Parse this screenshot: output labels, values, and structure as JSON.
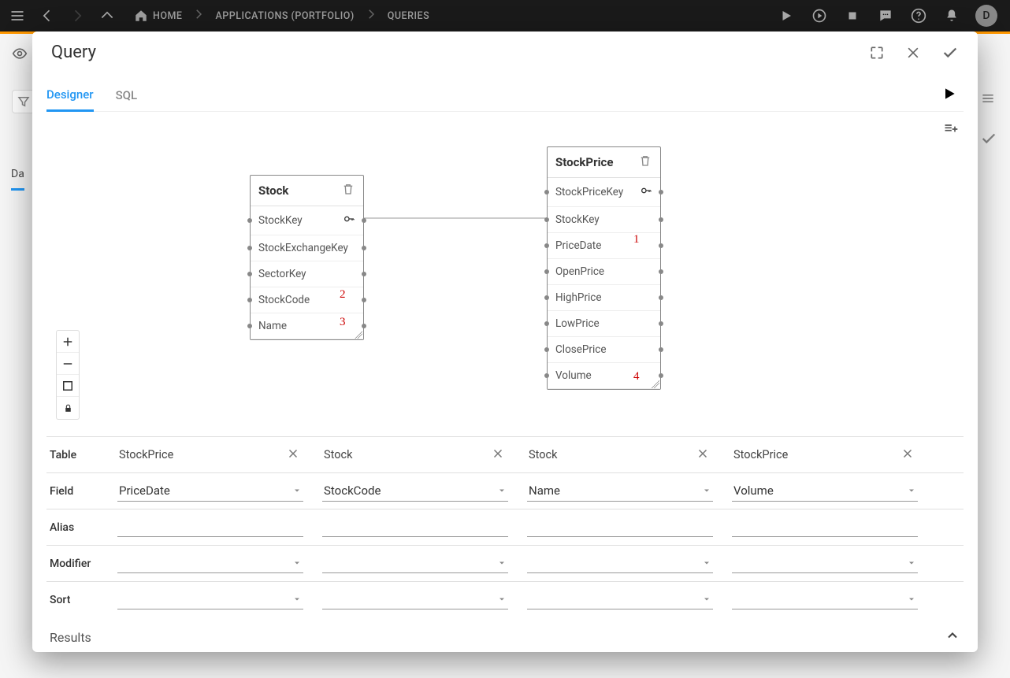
{
  "topbar": {
    "home": "HOME",
    "applications": "APPLICATIONS (PORTFOLIO)",
    "queries": "QUERIES",
    "avatar_letter": "D"
  },
  "bg": {
    "tab_truncated": "Da"
  },
  "dialog": {
    "title": "Query",
    "tabs": {
      "designer": "Designer",
      "sql": "SQL"
    },
    "entities": {
      "stock": {
        "title": "Stock",
        "fields": [
          "StockKey",
          "StockExchangeKey",
          "SectorKey",
          "StockCode",
          "Name"
        ]
      },
      "stockprice": {
        "title": "StockPrice",
        "fields": [
          "StockPriceKey",
          "StockKey",
          "PriceDate",
          "OpenPrice",
          "HighPrice",
          "LowPrice",
          "ClosePrice",
          "Volume"
        ]
      }
    },
    "annotations": {
      "a1": "1",
      "a2": "2",
      "a3": "3",
      "a4": "4"
    },
    "grid": {
      "labels": {
        "table": "Table",
        "field": "Field",
        "alias": "Alias",
        "modifier": "Modifier",
        "sort": "Sort"
      },
      "columns": [
        {
          "table": "StockPrice",
          "field": "PriceDate",
          "alias": "",
          "modifier": "",
          "sort": ""
        },
        {
          "table": "Stock",
          "field": "StockCode",
          "alias": "",
          "modifier": "",
          "sort": ""
        },
        {
          "table": "Stock",
          "field": "Name",
          "alias": "",
          "modifier": "",
          "sort": ""
        },
        {
          "table": "StockPrice",
          "field": "Volume",
          "alias": "",
          "modifier": "",
          "sort": ""
        }
      ]
    },
    "results_label": "Results"
  }
}
